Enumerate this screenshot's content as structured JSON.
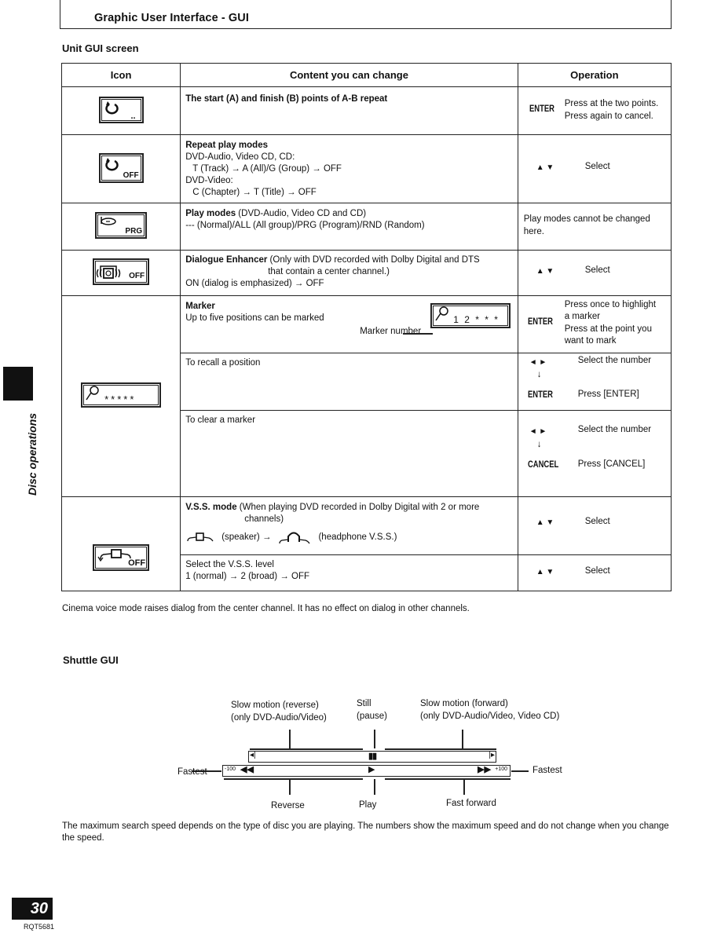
{
  "header": {
    "title": "Graphic User Interface - GUI"
  },
  "unit_gui": {
    "title": "Unit GUI screen",
    "columns": [
      "Icon",
      "Content you can change",
      "Operation"
    ],
    "rows": [
      {
        "icon": "ab-repeat-icon",
        "icon_text": "..",
        "content_title": "The start (A) and finish (B) points of A-B repeat",
        "content_lines": [],
        "op_key": "ENTER",
        "op_text": [
          "Press at the two points.",
          "Press again to cancel."
        ]
      },
      {
        "icon": "repeat-icon",
        "icon_text": "OFF",
        "content_title": "Repeat play modes",
        "content_lines": [
          "DVD-Audio, Video CD, CD:",
          "T (Track) → A (All)/G (Group) → OFF",
          "DVD-Video:",
          "C (Chapter) → T (Title) → OFF"
        ],
        "op_key": "▲ ▼",
        "op_text": [
          "Select"
        ]
      },
      {
        "icon": "play-mode-icon",
        "icon_text": "PRG",
        "content_title": "Play modes",
        "content_title_suffix": " (DVD-Audio, Video CD and CD)",
        "content_lines": [
          "--- (Normal)/ALL (All group)/PRG (Program)/RND (Random)"
        ],
        "op_key": "",
        "op_text": [
          "Play modes cannot be changed here."
        ]
      },
      {
        "icon": "dialogue-enhancer-icon",
        "icon_text": "OFF",
        "content_title": "Dialogue Enhancer",
        "content_title_suffix": "  (Only with DVD recorded with Dolby Digital and DTS",
        "content_lines": [
          "that contain a center channel.)",
          "ON (dialog is emphasized) → OFF"
        ],
        "op_key": "▲ ▼",
        "op_text": [
          "Select"
        ]
      }
    ],
    "marker": {
      "icon": "marker-pin-icon",
      "icon_text": "*****",
      "sub_rows": [
        {
          "content_title": "Marker",
          "content_lines": [
            "Up to five positions can be marked"
          ],
          "callout_label": "Marker number",
          "callout_icon_text": "1 2 * * *",
          "op_key": "ENTER",
          "op_text": [
            "Press once to highlight",
            "a marker",
            "Press at the point you",
            "want to mark"
          ]
        },
        {
          "content_title": "",
          "content_lines": [
            "To recall a position"
          ],
          "op_key1": "◄ ►",
          "op_text1": "Select the number",
          "op_down": "↓",
          "op_key2": "ENTER",
          "op_text2": "Press [ENTER]"
        },
        {
          "content_title": "",
          "content_lines": [
            "To clear a marker"
          ],
          "op_key1": "◄ ►",
          "op_text1": "Select the number",
          "op_down": "↓",
          "op_key2": "CANCEL",
          "op_text2": "Press [CANCEL]"
        }
      ]
    },
    "vss": {
      "icon": "vss-icon",
      "icon_text": "OFF",
      "sub_rows": [
        {
          "content_title": "V.S.S. mode",
          "content_title_suffix": " (When playing DVD recorded in Dolby Digital with 2 or more",
          "content_lines": [
            "channels)"
          ],
          "speaker_label": "(speaker) →",
          "headphone_label": "(headphone V.S.S.)",
          "op_key": "▲ ▼",
          "op_text": [
            "Select"
          ]
        },
        {
          "content_title": "",
          "content_lines": [
            "Select the V.S.S. level",
            "1 (normal) → 2 (broad) → OFF"
          ],
          "op_key": "▲ ▼",
          "op_text": [
            "Select"
          ]
        }
      ]
    },
    "note": "Cinema voice mode raises dialog from the center channel. It has no effect on dialog in other channels."
  },
  "shuttle_gui": {
    "title": "Shuttle GUI",
    "labels": {
      "slow_reverse": [
        "Slow motion (reverse)",
        "(only DVD-Audio/Video)"
      ],
      "still": [
        "Still",
        "(pause)"
      ],
      "slow_forward": [
        "Slow motion (forward)",
        "(only DVD-Audio/Video, Video CD)"
      ],
      "fastest_left": "Fastest",
      "fastest_right": "Fastest",
      "reverse": "Reverse",
      "play": "Play",
      "fast_forward": "Fast forward"
    },
    "bar": {
      "min_label": "-100",
      "max_label": "+100"
    },
    "note": "The maximum search speed depends on the type of disc you are playing. The numbers show the maximum speed and do not change when you change the speed."
  },
  "side_tab": {
    "label": "Disc operations"
  },
  "footer": {
    "page_number": "30",
    "doc_code": "RQT5681"
  }
}
